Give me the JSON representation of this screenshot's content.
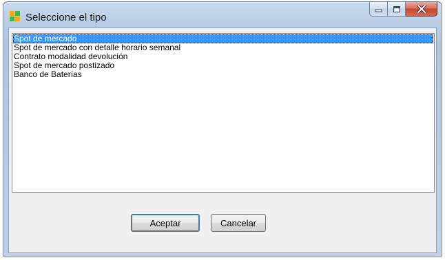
{
  "window": {
    "title": "Seleccione el tipo",
    "icon": "app-grid-icon"
  },
  "caption_buttons": {
    "minimize_icon": "minimize-icon",
    "maximize_icon": "maximize-icon",
    "close_icon": "close-icon"
  },
  "list": {
    "selected_index": 0,
    "items": [
      {
        "label": "Spot de mercado"
      },
      {
        "label": "Spot de mercado con detalle horario semanal"
      },
      {
        "label": "Contrato modalidad devolución"
      },
      {
        "label": "Spot de mercado postizado"
      },
      {
        "label": "Banco de Baterías"
      }
    ]
  },
  "buttons": {
    "ok_label": "Aceptar",
    "cancel_label": "Cancelar"
  },
  "colors": {
    "selection": "#3399ff",
    "close_button": "#c5452d",
    "titlebar": "#b9cde6"
  }
}
